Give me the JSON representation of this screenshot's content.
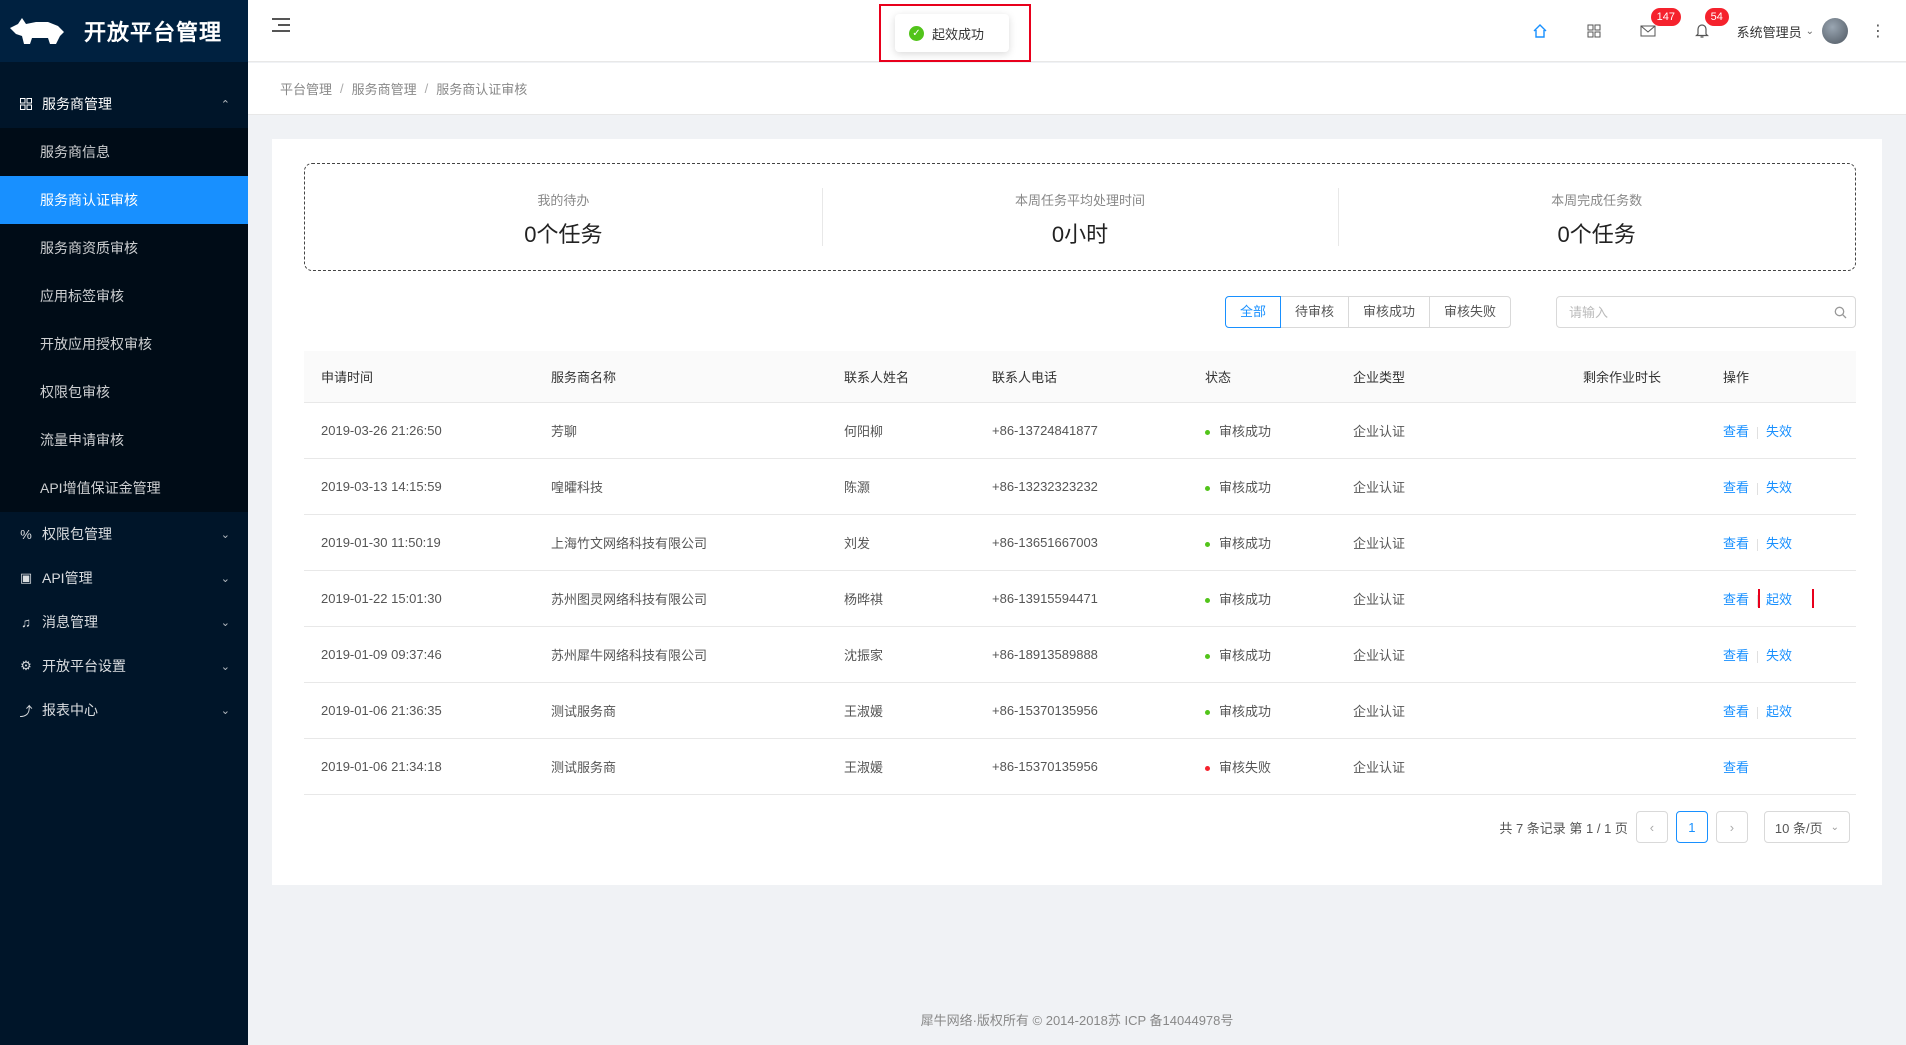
{
  "app": {
    "title": "开放平台管理"
  },
  "sidebar": {
    "open_group": {
      "label": "服务商管理",
      "arrow": "⌃"
    },
    "sub_items": [
      {
        "label": "服务商信息"
      },
      {
        "label": "服务商认证审核"
      },
      {
        "label": "服务商资质审核"
      },
      {
        "label": "应用标签审核"
      },
      {
        "label": "开放应用授权审核"
      },
      {
        "label": "权限包审核"
      },
      {
        "label": "流量申请审核"
      },
      {
        "label": "API增值保证金管理"
      }
    ],
    "groups": [
      {
        "label": "权限包管理",
        "icon": "%"
      },
      {
        "label": "API管理",
        "icon": "▣"
      },
      {
        "label": "消息管理",
        "icon": "♫"
      },
      {
        "label": "开放平台设置",
        "icon": "⚙"
      },
      {
        "label": "报表中心",
        "icon": "⤴"
      }
    ],
    "chevron": "⌄"
  },
  "header": {
    "mail_count": "147",
    "bell_count": "54",
    "user_name": "系统管理员",
    "user_caret": "⌄",
    "more": "⋮"
  },
  "toast": {
    "message": "起效成功",
    "icon": "✓"
  },
  "breadcrumb": [
    "平台管理",
    "服务商管理",
    "服务商认证审核"
  ],
  "breadcrumb_sep": "/",
  "stats": [
    {
      "label": "我的待办",
      "value": "0个任务"
    },
    {
      "label": "本周任务平均处理时间",
      "value": "0小时"
    },
    {
      "label": "本周完成任务数",
      "value": "0个任务"
    }
  ],
  "filters": {
    "tabs": [
      "全部",
      "待审核",
      "审核成功",
      "审核失败"
    ],
    "active": "全部"
  },
  "search": {
    "placeholder": "请输入",
    "value": ""
  },
  "table": {
    "columns": [
      "申请时间",
      "服务商名称",
      "联系人姓名",
      "联系人电话",
      "状态",
      "企业类型",
      "剩余作业时长",
      "操作"
    ],
    "status_colors": {
      "success": "#52c41a",
      "fail": "#f5222d"
    },
    "rows": [
      {
        "time": "2019-03-26 21:26:50",
        "name": "芳聊",
        "contact": "何阳柳",
        "phone": "+86-13724841877",
        "status": "审核成功",
        "status_color": "#52c41a",
        "type": "企业认证",
        "remain": "",
        "view": "查看",
        "action": "失效"
      },
      {
        "time": "2019-03-13 14:15:59",
        "name": "喤曤科技",
        "contact": "陈灏",
        "phone": "+86-13232323232",
        "status": "审核成功",
        "status_color": "#52c41a",
        "type": "企业认证",
        "remain": "",
        "view": "查看",
        "action": "失效"
      },
      {
        "time": "2019-01-30 11:50:19",
        "name": "上海竹文网络科技有限公司",
        "contact": "刘发",
        "phone": "+86-13651667003",
        "status": "审核成功",
        "status_color": "#52c41a",
        "type": "企业认证",
        "remain": "",
        "view": "查看",
        "action": "失效"
      },
      {
        "time": "2019-01-22 15:01:30",
        "name": "苏州图灵网络科技有限公司",
        "contact": "杨晔祺",
        "phone": "+86-13915594471",
        "status": "审核成功",
        "status_color": "#52c41a",
        "type": "企业认证",
        "remain": "",
        "view": "查看",
        "action": "起效"
      },
      {
        "time": "2019-01-09 09:37:46",
        "name": "苏州犀牛网络科技有限公司",
        "contact": "沈振家",
        "phone": "+86-18913589888",
        "status": "审核成功",
        "status_color": "#52c41a",
        "type": "企业认证",
        "remain": "",
        "view": "查看",
        "action": "失效"
      },
      {
        "time": "2019-01-06 21:36:35",
        "name": "测试服务商",
        "contact": "王淑媛",
        "phone": "+86-15370135956",
        "status": "审核成功",
        "status_color": "#52c41a",
        "type": "企业认证",
        "remain": "",
        "view": "查看",
        "action": "起效"
      },
      {
        "time": "2019-01-06 21:34:18",
        "name": "测试服务商",
        "contact": "王淑媛",
        "phone": "+86-15370135956",
        "status": "审核失败",
        "status_color": "#f5222d",
        "type": "企业认证",
        "remain": "",
        "view": "查看",
        "action": ""
      }
    ]
  },
  "pagination": {
    "summary": "共 7 条记录 第 1 / 1 页",
    "current": "1",
    "prev": "‹",
    "next": "›",
    "page_size": "10 条/页",
    "caret": "⌄"
  },
  "footer": {
    "text": "犀牛网络·版权所有 © 2014-2018苏 ICP 备14044978号"
  }
}
